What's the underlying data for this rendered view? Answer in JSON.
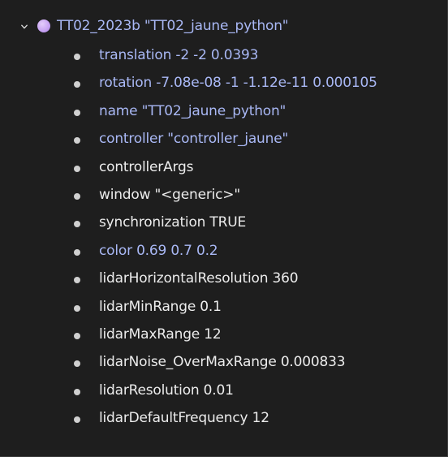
{
  "tree": {
    "root": {
      "label": "TT02_2023b \"TT02_jaune_python\"",
      "expanded": true,
      "icon": "robot-node-icon"
    },
    "fields": [
      {
        "label": "translation -2 -2 0.0393",
        "modified": true
      },
      {
        "label": "rotation -7.08e-08 -1 -1.12e-11 0.000105",
        "modified": true
      },
      {
        "label": "name \"TT02_jaune_python\"",
        "modified": true
      },
      {
        "label": "controller \"controller_jaune\"",
        "modified": true
      },
      {
        "label": "controllerArgs",
        "modified": false
      },
      {
        "label": "window \"<generic>\"",
        "modified": false
      },
      {
        "label": "synchronization TRUE",
        "modified": false
      },
      {
        "label": "color 0.69 0.7 0.2",
        "modified": true
      },
      {
        "label": "lidarHorizontalResolution 360",
        "modified": false
      },
      {
        "label": "lidarMinRange 0.1",
        "modified": false
      },
      {
        "label": "lidarMaxRange 12",
        "modified": false
      },
      {
        "label": "lidarNoise_OverMaxRange 0.000833",
        "modified": false
      },
      {
        "label": "lidarResolution 0.01",
        "modified": false
      },
      {
        "label": "lidarDefaultFrequency 12",
        "modified": false
      }
    ]
  },
  "colors": {
    "background": "#1e1e1e",
    "modified_text": "#a9b8f5",
    "default_text": "#ececec",
    "bullet": "#d0d0d0",
    "root_icon": "#c9a5f3"
  }
}
